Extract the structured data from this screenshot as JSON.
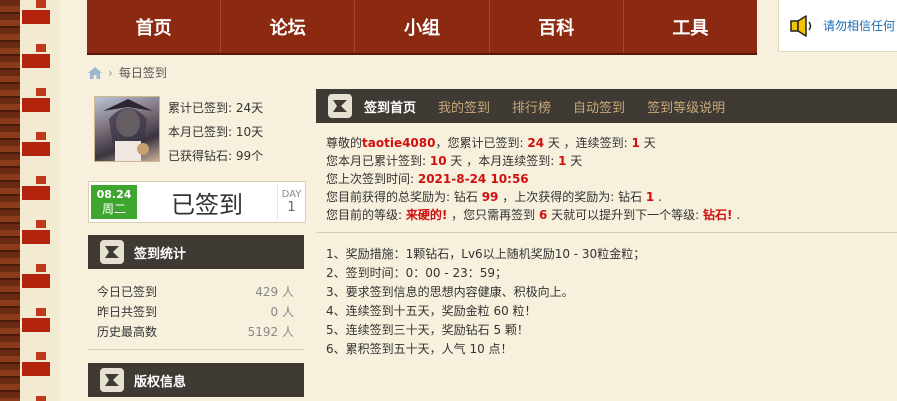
{
  "nav": {
    "items": [
      {
        "label": "首页"
      },
      {
        "label": "论坛"
      },
      {
        "label": "小组"
      },
      {
        "label": "百科"
      },
      {
        "label": "工具"
      }
    ]
  },
  "notice": {
    "text": "请勿相信任何"
  },
  "breadcrumb": {
    "current": "每日签到"
  },
  "profile": {
    "total_label": "累计已签到:",
    "total_value": "24天",
    "month_label": "本月已签到:",
    "month_value": "10天",
    "diamond_label": "已获得钻石:",
    "diamond_value": "99个"
  },
  "signed": {
    "date": "08.24",
    "weekday": "周二",
    "label": "已签到",
    "day_label": "DAY",
    "day_value": "1"
  },
  "stats_panel": {
    "title": "签到统计",
    "rows": [
      {
        "label": "今日已签到",
        "value": "429 人"
      },
      {
        "label": "昨日共签到",
        "value": "0 人"
      },
      {
        "label": "历史最高数",
        "value": "5192 人"
      }
    ]
  },
  "copyright_panel": {
    "title": "版权信息"
  },
  "tabs": [
    {
      "label": "签到首页"
    },
    {
      "label": "我的签到"
    },
    {
      "label": "排行榜"
    },
    {
      "label": "自动签到"
    },
    {
      "label": "签到等级说明"
    }
  ],
  "info": {
    "l1_a": "尊敬的",
    "user": "taotie4080",
    "l1_b": "，您累计已签到: ",
    "total": "24",
    "l1_c": " 天 ，连续签到: ",
    "streak": "1",
    "l1_d": " 天",
    "l2_a": "您本月已累计签到: ",
    "month": "10",
    "l2_b": " 天 ，本月连续签到: ",
    "month_streak": "1",
    "l2_c": " 天",
    "l3_a": "您上次签到时间: ",
    "last_time": "2021-8-24 10:56",
    "l4_a": "您目前获得的总奖励为: 钻石 ",
    "diamond_total": "99",
    "l4_b": " ，上次获得的奖励为: 钻石 ",
    "diamond_last": "1",
    "l4_c": " .",
    "l5_a": "您目前的等级: ",
    "level": "来硬的!",
    "l5_b": " ，您只需再签到 ",
    "days_needed": "6",
    "l5_c": " 天就可以提升到下一个等级: ",
    "next_level": "钻石!",
    "l5_d": " ."
  },
  "rules": [
    "1、奖励措施：1颗钻石，Lv6以上随机奖励10 - 30粒金粒；",
    "2、签到时间：0：00 - 23：59；",
    "3、要求签到信息的思想内容健康、积极向上。",
    "4、连续签到十五天，奖励金粒 60 粒！",
    "5、连续签到三十天，奖励钻石 5 颗！",
    "6、累积签到五十天，人气 10 点！"
  ]
}
